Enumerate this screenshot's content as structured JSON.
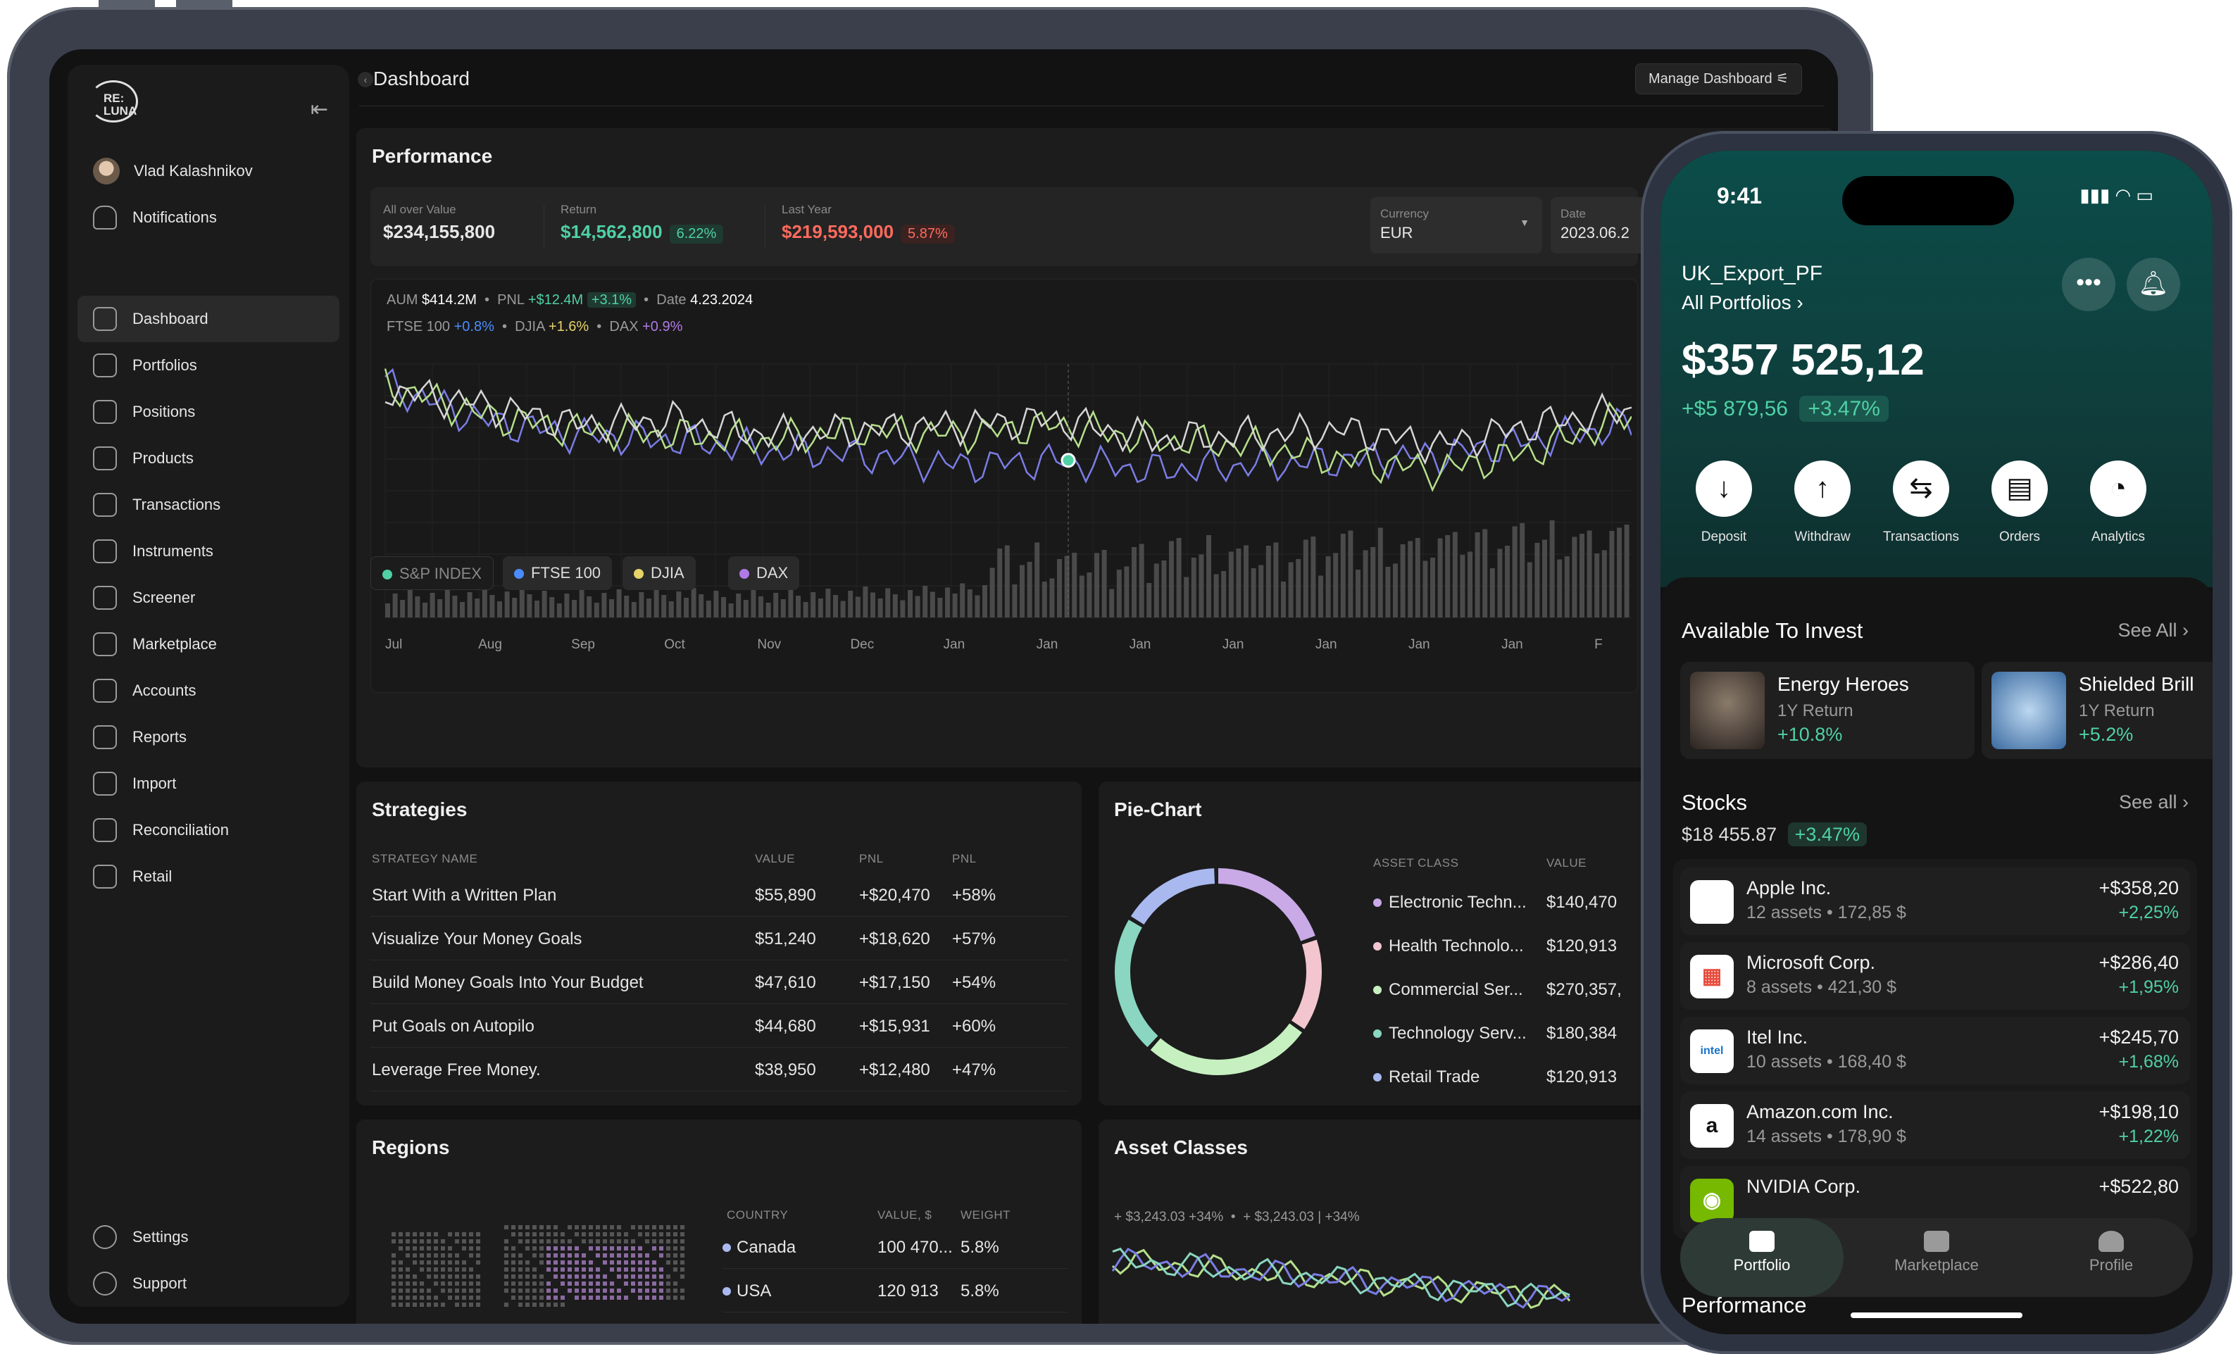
{
  "sidebar": {
    "logo": "RE:\nLUNA",
    "user": "Vlad Kalashnikov",
    "notifications": "Notifications",
    "items": [
      {
        "label": "Dashboard",
        "icon": "dashboard-icon"
      },
      {
        "label": "Portfolios",
        "icon": "briefcase-icon"
      },
      {
        "label": "Positions",
        "icon": "layers-icon"
      },
      {
        "label": "Products",
        "icon": "box-icon"
      },
      {
        "label": "Transactions",
        "icon": "exchange-icon"
      },
      {
        "label": "Instruments",
        "icon": "dollar-icon"
      },
      {
        "label": "Screener",
        "icon": "flag-icon"
      },
      {
        "label": "Marketplace",
        "icon": "store-icon"
      },
      {
        "label": "Accounts",
        "icon": "users-icon"
      },
      {
        "label": "Reports",
        "icon": "cloud-icon"
      },
      {
        "label": "Import",
        "icon": "import-icon"
      },
      {
        "label": "Reconciliation",
        "icon": "refresh-icon"
      },
      {
        "label": "Retail",
        "icon": "folder-icon"
      }
    ],
    "settings": "Settings",
    "support": "Support"
  },
  "header": {
    "title": "Dashboard",
    "manage": "Manage Dashboard"
  },
  "performance": {
    "title": "Performance",
    "all_over_label": "All over Value",
    "all_over_value": "$234,155,800",
    "return_label": "Return",
    "return_value": "$14,562,800",
    "return_pct": "6.22%",
    "last_year_label": "Last Year",
    "last_year_value": "$219,593,000",
    "last_year_pct": "5.87%",
    "currency_label": "Currency",
    "currency_value": "EUR",
    "date_label": "Date",
    "date_value": "2023.06.2",
    "legend1": {
      "aum_l": "AUM",
      "aum": "$414.2M",
      "pnl_l": "PNL",
      "pnl": "+$12.4M",
      "pnl_pct": "+3.1%",
      "date_l": "Date",
      "date": "4.23.2024"
    },
    "legend2": {
      "ftse_l": "FTSE 100",
      "ftse": "+0.8%",
      "djia_l": "DJIA",
      "djia": "+1.6%",
      "dax_l": "DAX",
      "dax": "+0.9%"
    },
    "chips": [
      {
        "label": "S&P INDEX",
        "color": "#4fd1a5"
      },
      {
        "label": "FTSE 100",
        "color": "#4a8cff"
      },
      {
        "label": "DJIA",
        "color": "#e6d36a"
      },
      {
        "label": "DAX",
        "color": "#b07ae6"
      }
    ]
  },
  "chart_data": {
    "type": "line",
    "categories": [
      "Jul",
      "Aug",
      "Sep",
      "Oct",
      "Nov",
      "Dec",
      "Jan",
      "Jan",
      "Jan",
      "Jan",
      "Jan",
      "Jan",
      "Jan",
      "F"
    ],
    "series": [
      {
        "name": "FTSE 100",
        "color": "#7b7de6",
        "values": [
          92,
          78,
          72,
          70,
          66,
          64,
          60,
          62,
          58,
          60,
          62,
          64,
          70,
          76
        ]
      },
      {
        "name": "DJIA",
        "color": "#b6e08a",
        "values": [
          92,
          80,
          74,
          72,
          70,
          74,
          72,
          76,
          70,
          68,
          62,
          58,
          66,
          80
        ]
      },
      {
        "name": "DAX",
        "color": "#d6d6d6",
        "values": [
          90,
          84,
          76,
          78,
          72,
          74,
          76,
          78,
          70,
          72,
          74,
          68,
          76,
          82
        ]
      }
    ]
  },
  "strategies": {
    "title": "Strategies",
    "headers": [
      "STRATEGY NAME",
      "VALUE",
      "PNL",
      "PNL"
    ],
    "rows": [
      [
        "Start With a Written Plan",
        "$55,890",
        "+$20,470",
        "+58%"
      ],
      [
        "Visualize Your Money Goals",
        "$51,240",
        "+$18,620",
        "+57%"
      ],
      [
        "Build Money Goals Into Your Budget",
        "$47,610",
        "+$17,150",
        "+54%"
      ],
      [
        "Put Goals on Autopilo",
        "$44,680",
        "+$15,931",
        "+60%"
      ],
      [
        "Leverage Free Money.",
        "$38,950",
        "+$12,480",
        "+47%"
      ]
    ]
  },
  "pie": {
    "title": "Pie-Chart",
    "headers": [
      "ASSET CLASS",
      "VALUE"
    ],
    "rows": [
      {
        "name": "Electronic Techn...",
        "value": "$140,470",
        "color": "#c9a9e6"
      },
      {
        "name": "Health Technolo...",
        "value": "$120,913",
        "color": "#f3c6cf"
      },
      {
        "name": "Commercial Ser...",
        "value": "$270,357,",
        "color": "#c6f0c0"
      },
      {
        "name": "Technology Serv...",
        "value": "$180,384",
        "color": "#8ad6c0"
      },
      {
        "name": "Retail Trade",
        "value": "$120,913",
        "color": "#a9b9f0"
      }
    ]
  },
  "regions": {
    "title": "Regions",
    "headers": [
      "COUNTRY",
      "VALUE, $",
      "WEIGHT"
    ],
    "rows": [
      [
        "Canada",
        "100 470...",
        "5.8%"
      ],
      [
        "USA",
        "120 913",
        "5.8%"
      ]
    ]
  },
  "asset_classes": {
    "title": "Asset Classes",
    "legend_a": "+ $3,243.03 +34%",
    "legend_b": "+ $3,243.03 | +34%"
  },
  "phone": {
    "time": "9:41",
    "portfolio": "UK_Export_PF",
    "all": "All Portfolios",
    "balance": "$357 525,12",
    "change": "+$5 879,56",
    "change_pct": "+3.47%",
    "actions": [
      {
        "label": "Deposit",
        "glyph": "↓"
      },
      {
        "label": "Withdraw",
        "glyph": "↑"
      },
      {
        "label": "Transactions",
        "glyph": "⇆"
      },
      {
        "label": "Orders",
        "glyph": "▤"
      },
      {
        "label": "Analytics",
        "glyph": "◔"
      }
    ],
    "available": "Available To Invest",
    "see_all": "See All",
    "invest": [
      {
        "name": "Energy Heroes",
        "ret_l": "1Y Return",
        "ret": "+10.8%"
      },
      {
        "name": "Shielded Brill",
        "ret_l": "1Y Return",
        "ret": "+5.2%"
      }
    ],
    "stocks_title": "Stocks",
    "stocks_see": "See all",
    "stocks_value": "$18 455.87",
    "stocks_pct": "+3.47%",
    "stocks": [
      {
        "name": "Apple Inc.",
        "sub": "12 assets • 172,85 $",
        "value": "+$358,20",
        "pct": "+2,25%",
        "logo": ""
      },
      {
        "name": "Microsoft Corp.",
        "sub": "8 assets • 421,30 $",
        "value": "+$286,40",
        "pct": "+1,95%",
        "logo": "▦"
      },
      {
        "name": "Itel Inc.",
        "sub": "10 assets • 168,40 $",
        "value": "+$245,70",
        "pct": "+1,68%",
        "logo": "intel"
      },
      {
        "name": "Amazon.com Inc.",
        "sub": "14 assets • 178,90 $",
        "value": "+$198,10",
        "pct": "+1,22%",
        "logo": "a"
      },
      {
        "name": "NVIDIA Corp.",
        "sub": "",
        "value": "+$522,80",
        "pct": "",
        "logo": "◉"
      }
    ],
    "tabs": [
      "Portfolio",
      "Marketplace",
      "Profile"
    ],
    "performance": "Performance"
  }
}
